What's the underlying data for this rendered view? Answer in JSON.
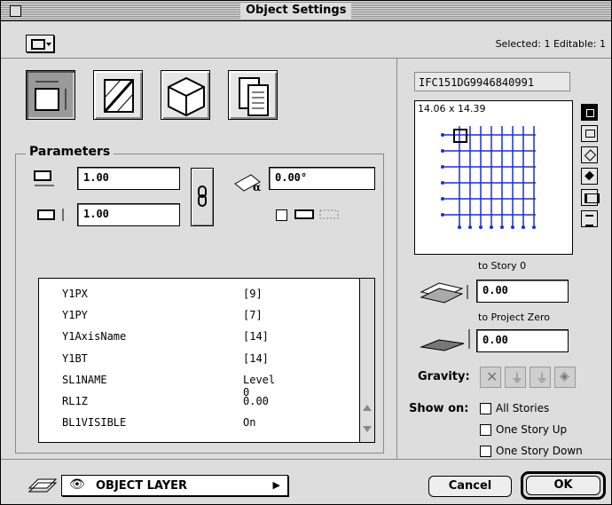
{
  "window": {
    "title": "Object Settings"
  },
  "selection_info": "Selected: 1 Editable: 1",
  "section": {
    "parameters_title": "Parameters"
  },
  "parameters": {
    "width": "1.00",
    "depth": "1.00",
    "angle": "0.00°"
  },
  "table": {
    "rows": [
      {
        "name": "Y1PX",
        "value": "[9]"
      },
      {
        "name": "Y1PY",
        "value": "[7]"
      },
      {
        "name": "Y1AxisName",
        "value": "[14]"
      },
      {
        "name": "Y1BT",
        "value": "[14]"
      },
      {
        "name": "SL1NAME",
        "value": "Level 0"
      },
      {
        "name": "RL1Z",
        "value": "0.00"
      },
      {
        "name": "BL1VISIBLE",
        "value": "On"
      }
    ]
  },
  "preview": {
    "id": "IFC151DG9946840991",
    "size": "14.06 x 14.39"
  },
  "elevation": {
    "to_story_label": "to Story 0",
    "to_story_value": "0.00",
    "to_project_label": "to Project Zero",
    "to_project_value": "0.00"
  },
  "gravity": {
    "label": "Gravity:"
  },
  "show_on": {
    "label": "Show on:",
    "options": [
      "All Stories",
      "One Story Up",
      "One Story Down"
    ]
  },
  "layer": {
    "name": "OBJECT LAYER"
  },
  "buttons": {
    "cancel": "Cancel",
    "ok": "OK"
  },
  "colors": {
    "window_bg": "#dddddd",
    "grid_blue": "#1a2fd6"
  }
}
